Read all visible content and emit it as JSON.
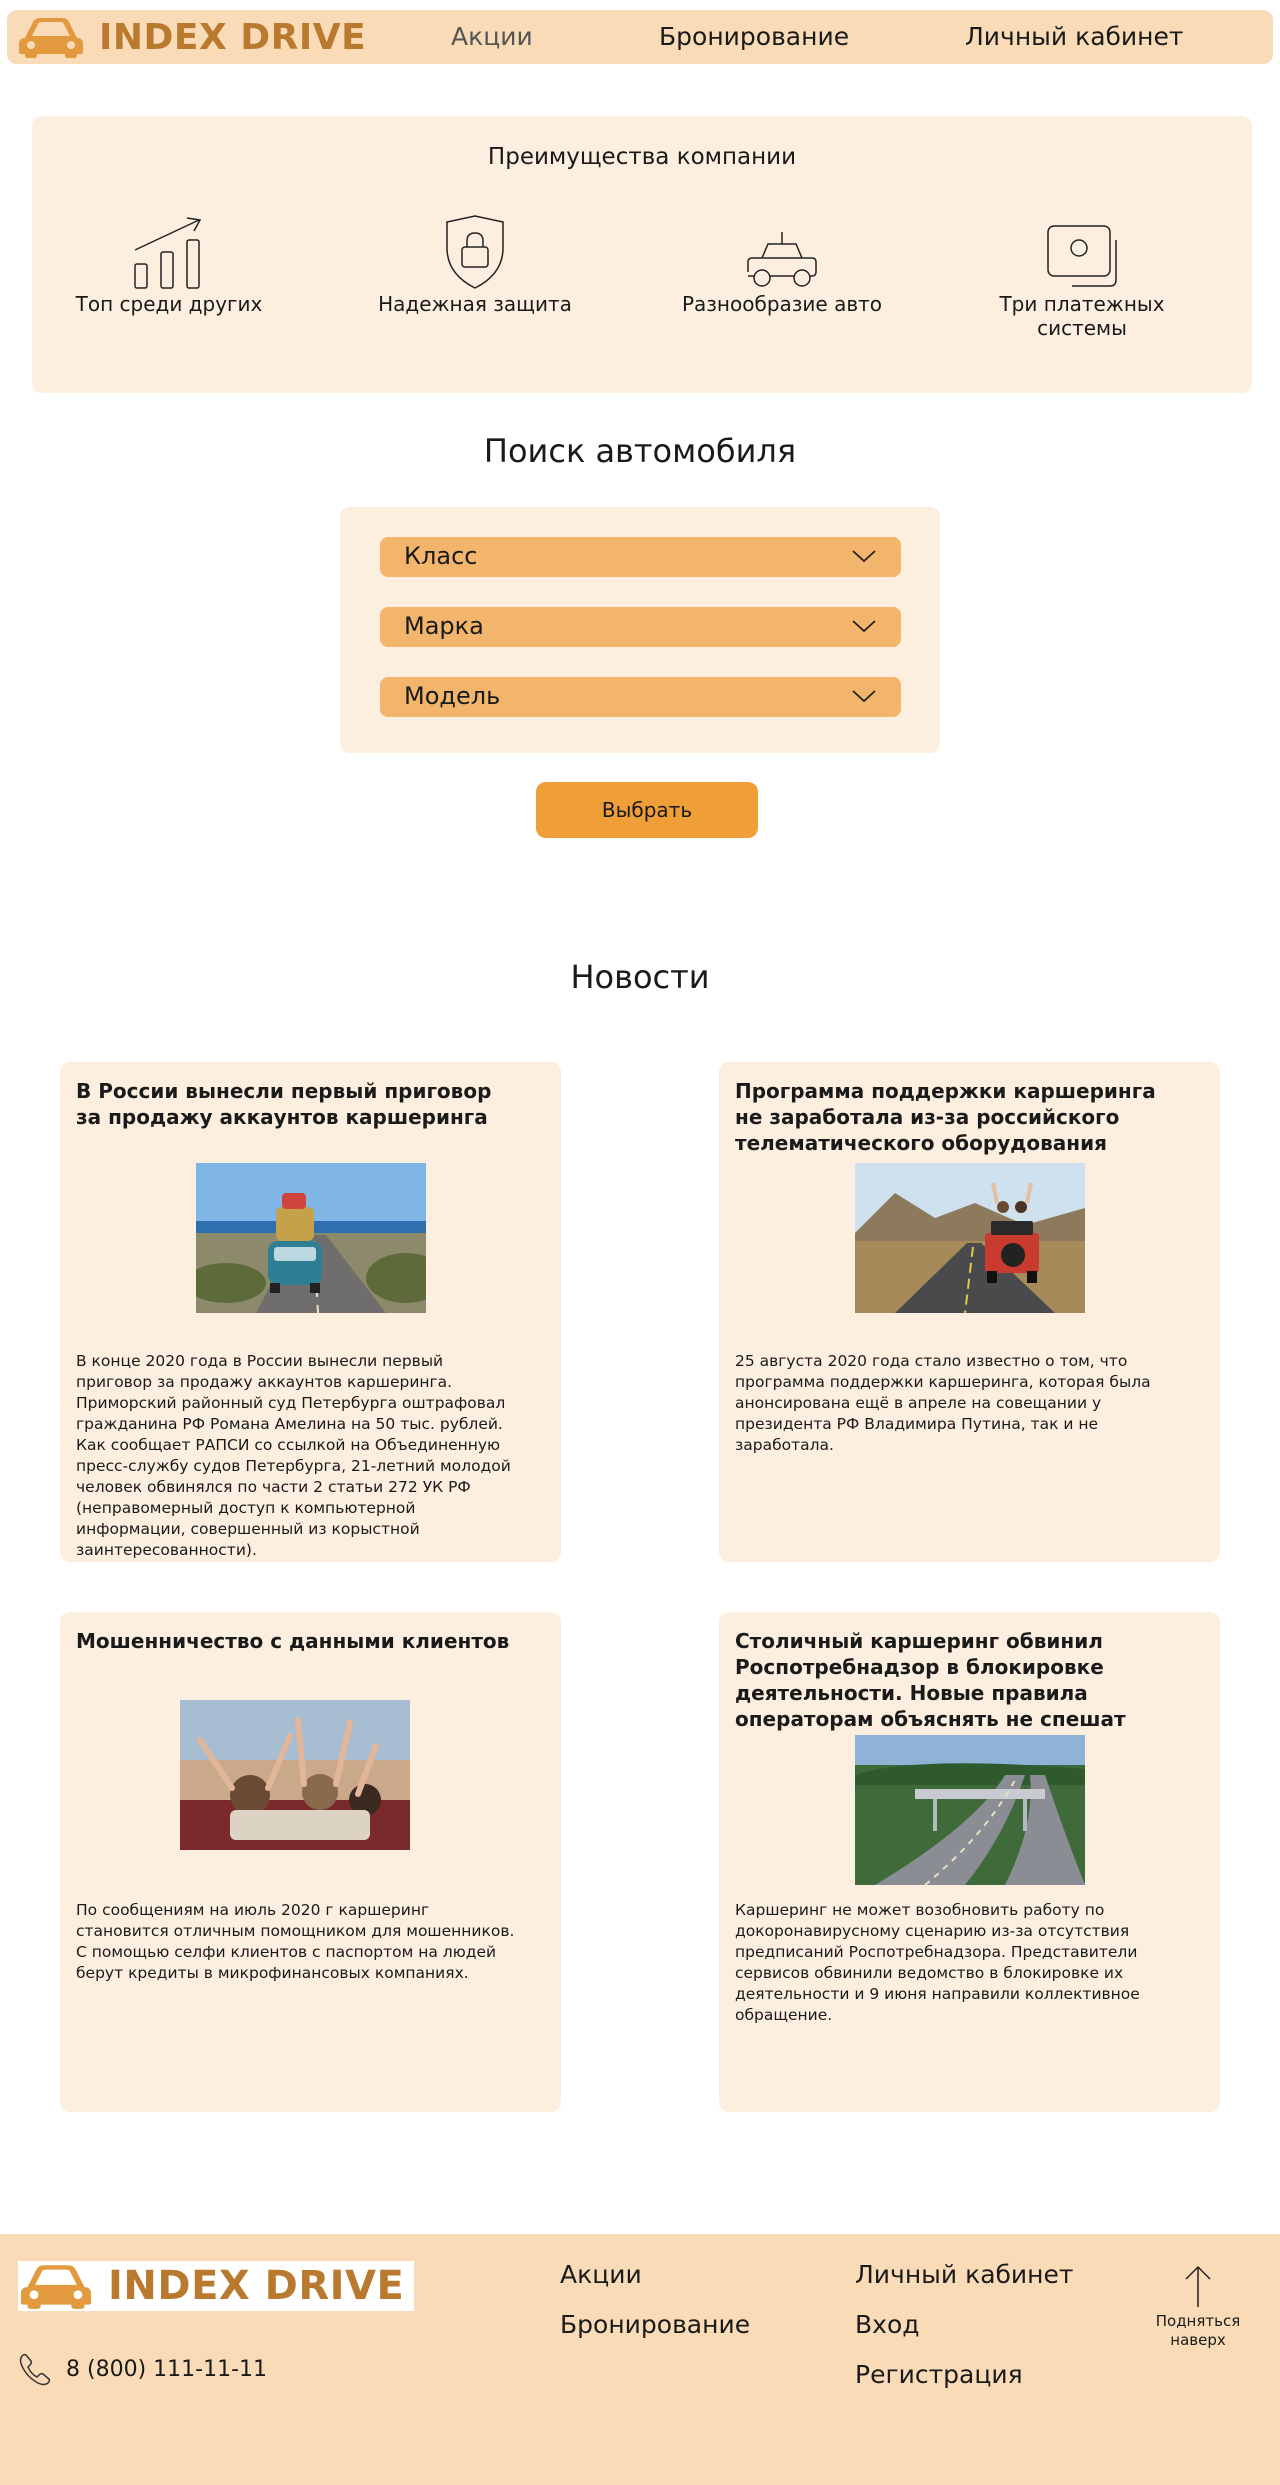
{
  "header": {
    "brand": "INDEX DRIVE",
    "nav": [
      "Акции",
      "Бронирование",
      "Личный кабинет"
    ]
  },
  "advantages": {
    "title": "Преимущества компании",
    "items": [
      {
        "label": "Топ среди других",
        "icon": "growth-chart-icon"
      },
      {
        "label": "Надежная защита",
        "icon": "shield-lock-icon"
      },
      {
        "label": "Разнообразие авто",
        "icon": "car-icon"
      },
      {
        "label": "Три платежных системы",
        "icon": "payment-card-icon"
      }
    ]
  },
  "search": {
    "title": "Поиск автомобиля",
    "fields": [
      "Класс",
      "Марка",
      "Модель"
    ],
    "button": "Выбрать"
  },
  "news": {
    "title": "Новости",
    "cards": [
      {
        "title": "В России вынесли первый приговор за продажу аккаунтов каршеринга",
        "text": [
          "В конце 2020 года в России вынесли первый приговор за продажу аккаунтов каршеринга. Приморский районный суд Петербурга оштрафовал гражданина РФ Романа Амелина на 50 тыс. рублей.",
          "Как сообщает РАПСИ со ссылкой на Объединенную пресс-службу судов Петербурга, 21-летний молодой человек обвинялся по части 2 статьи 272 УК РФ (неправомерный доступ к компьютерной информации, совершенный из корыстной заинтересованности)."
        ]
      },
      {
        "title": "Программа поддержки каршеринга не заработала из-за российского телематического оборудования",
        "text": [
          "25 августа 2020 года стало известно о том, что программа поддержки каршеринга, которая была анонсирована ещё в апреле на совещании у президента РФ Владимира Путина, так и не заработала."
        ]
      },
      {
        "title": "Мошенничество с данными клиентов",
        "text": [
          "По сообщениям на июль 2020 г каршеринг становится отличным помощником для мошенников.",
          "С помощью селфи клиентов с паспортом на людей берут кредиты в микрофинансовых компаниях."
        ]
      },
      {
        "title": "Столичный каршеринг обвинил Роспотребнадзор в блокировке деятельности. Новые правила операторам объяснять не спешат",
        "text": [
          "Каршеринг не может возобновить работу по докоронавирусному сценарию из-за отсутствия предписаний Роспотребнадзора. Представители сервисов обвинили ведомство в блокировке их деятельности и 9 июня направили коллективное обращение."
        ]
      }
    ]
  },
  "footer": {
    "brand": "INDEX DRIVE",
    "links_col1": [
      "Акции",
      "Бронирование"
    ],
    "links_col2": [
      "Личный кабинет",
      "Вход",
      "Регистрация"
    ],
    "phone": "8 (800) 111-11-11",
    "up_label": "Подняться наверх"
  },
  "colors": {
    "header_bg": "#f9dcb7",
    "card_bg": "#fcefe0",
    "select_bg": "#f2b56b",
    "button_bg": "#ef9e38",
    "brand_text": "#b97a2f"
  }
}
